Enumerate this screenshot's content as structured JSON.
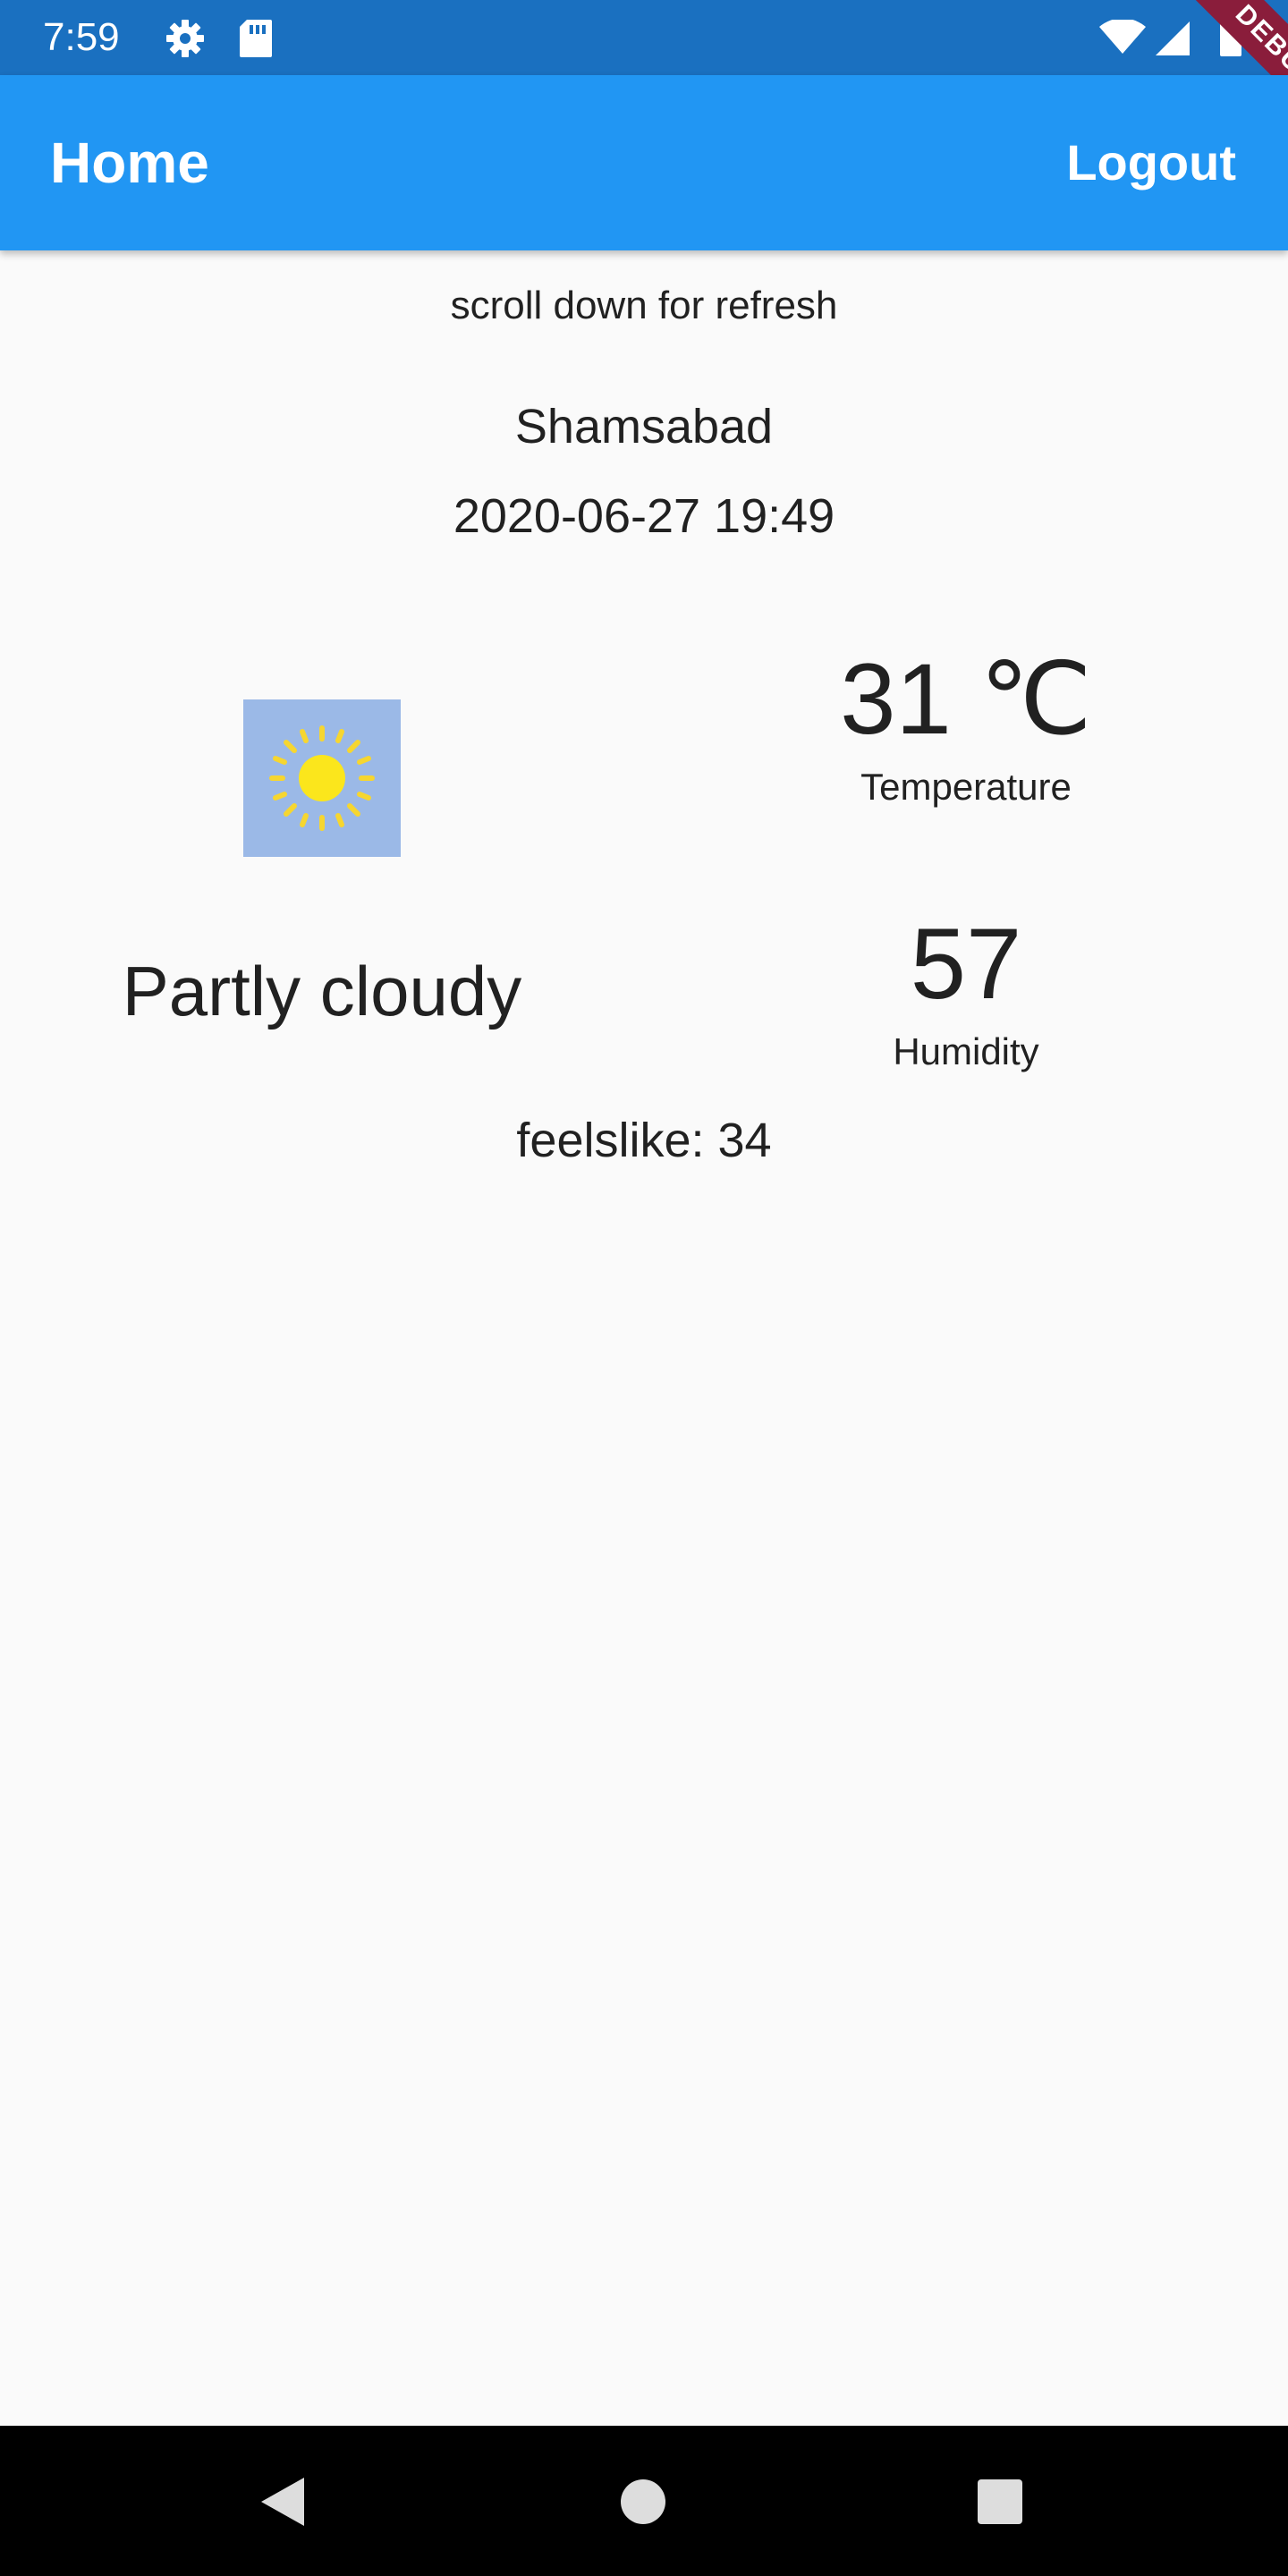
{
  "status_bar": {
    "time": "7:59",
    "icons": [
      "gear-icon",
      "sd-card-icon",
      "wifi-icon",
      "signal-icon",
      "battery-icon"
    ]
  },
  "app_bar": {
    "title": "Home",
    "logout_label": "Logout",
    "color": "#2196f3"
  },
  "debug_banner": "DEBUG",
  "weather": {
    "hint": "scroll down for refresh",
    "location": "Shamsabad",
    "datetime": "2020-06-27 19:49",
    "condition": "Partly cloudy",
    "condition_icon": "sun-icon",
    "temperature": "31 ℃",
    "temperature_label": "Temperature",
    "humidity": "57",
    "humidity_label": "Humidity",
    "feelslike": "feelslike: 34"
  },
  "nav_bar": {
    "buttons": [
      "back-icon",
      "home-icon",
      "recents-icon"
    ]
  }
}
